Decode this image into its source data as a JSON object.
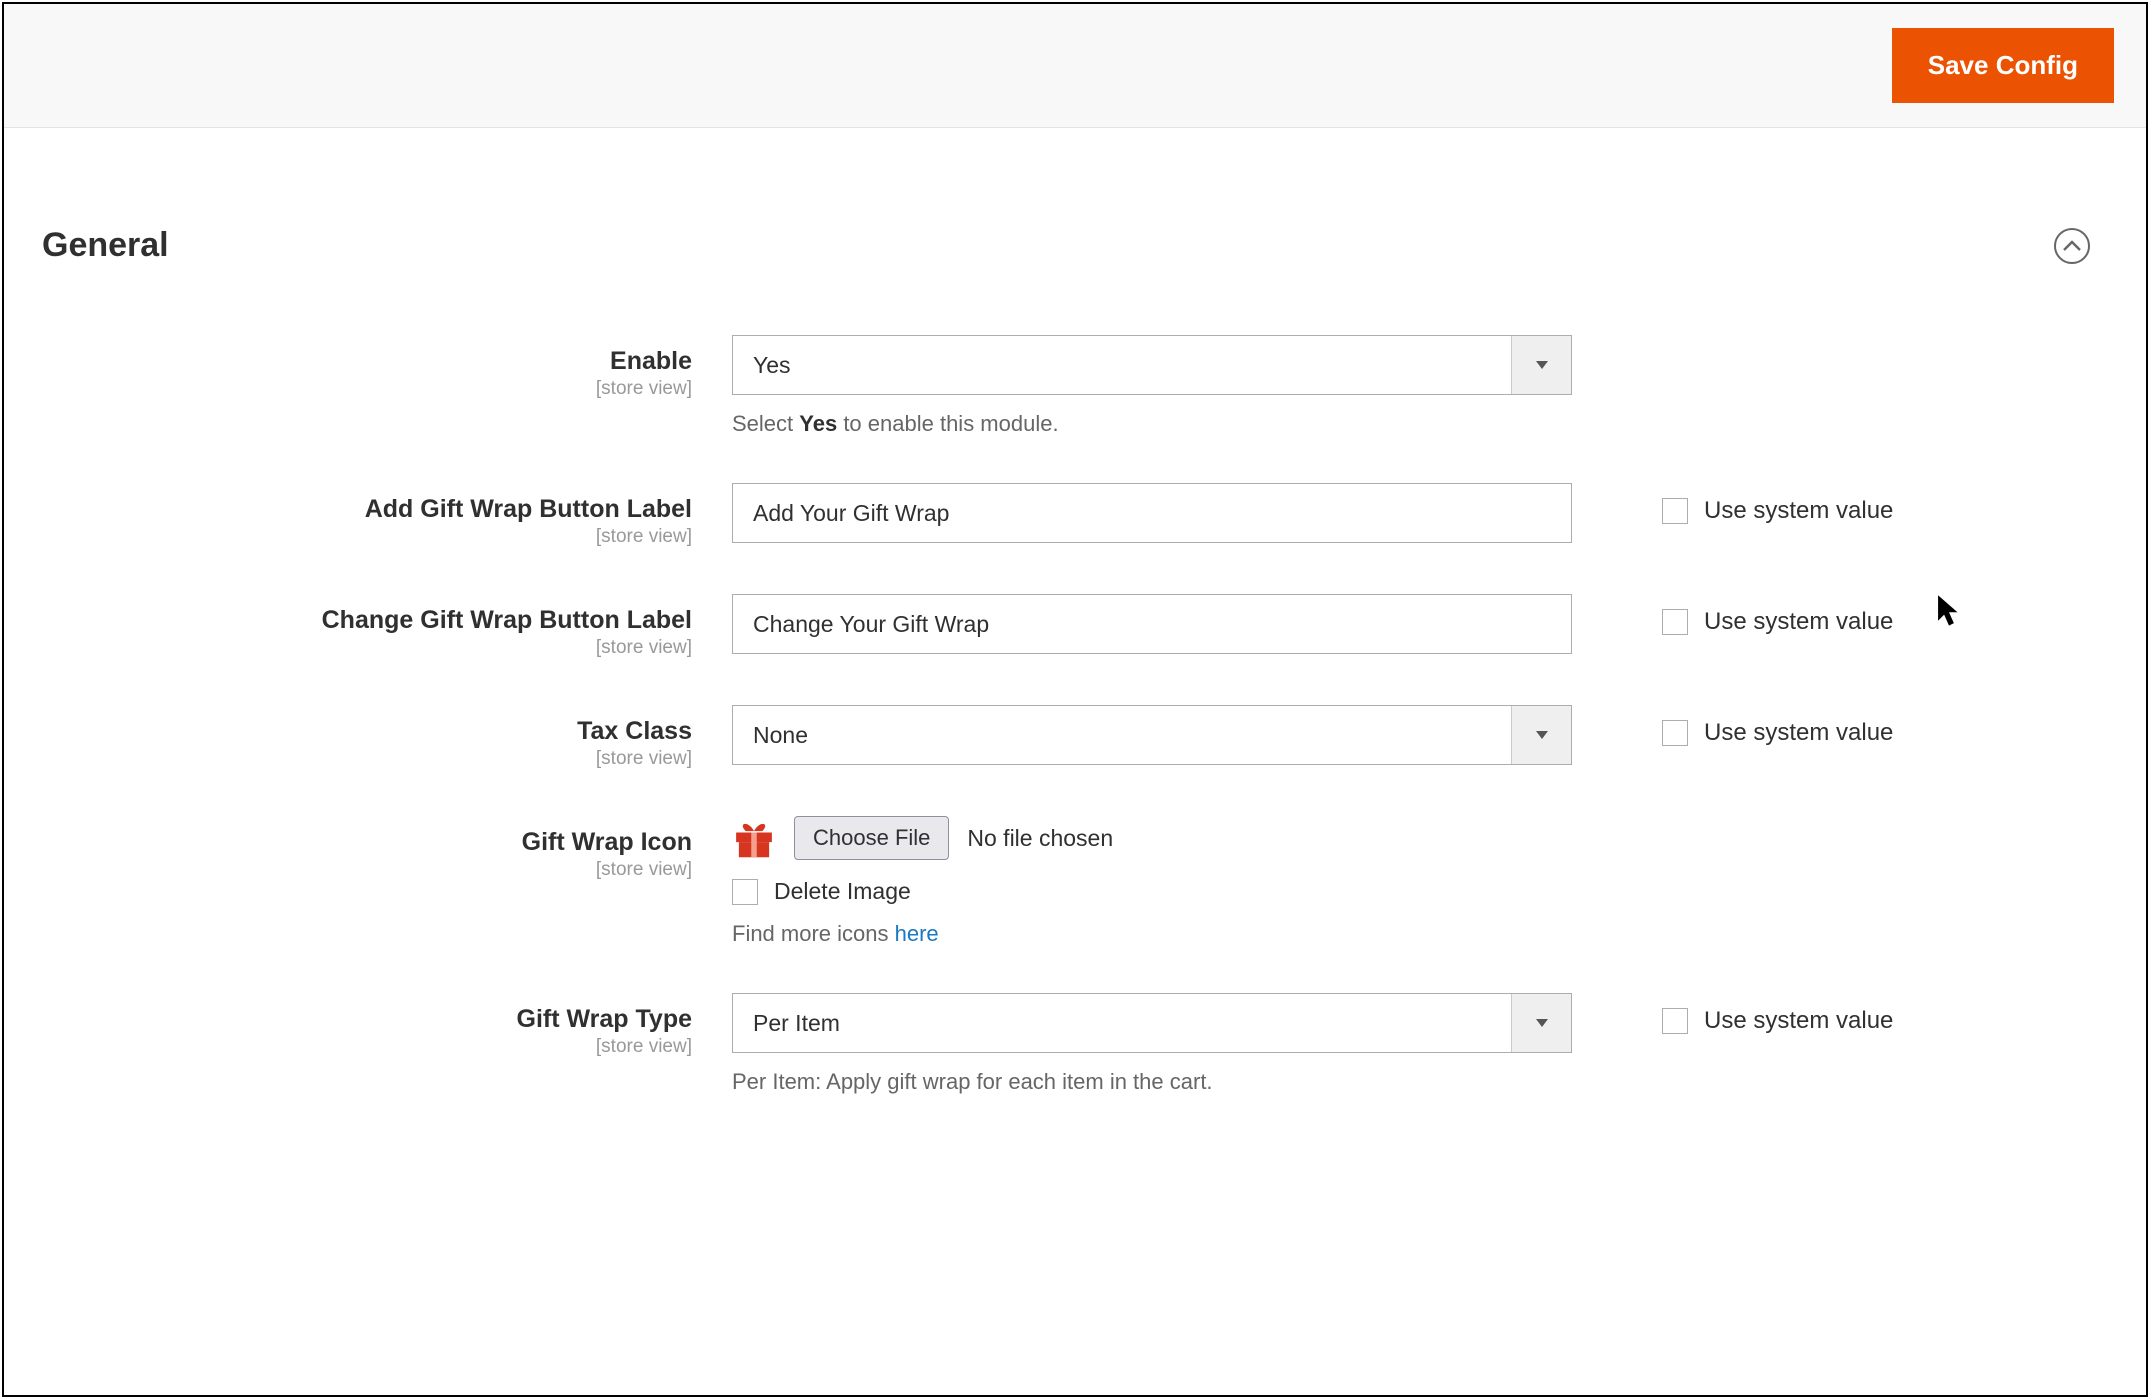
{
  "header": {
    "save_label": "Save Config"
  },
  "section": {
    "title": "General"
  },
  "scope_label": "[store view]",
  "useSystemValue": "Use system value",
  "fields": {
    "enable": {
      "label": "Enable",
      "value": "Yes",
      "helper_pre": "Select ",
      "helper_strong": "Yes",
      "helper_post": " to enable this module."
    },
    "addBtnLabel": {
      "label": "Add Gift Wrap Button Label",
      "value": "Add Your Gift Wrap"
    },
    "changeBtnLabel": {
      "label": "Change Gift Wrap Button Label",
      "value": "Change Your Gift Wrap"
    },
    "taxClass": {
      "label": "Tax Class",
      "value": "None"
    },
    "giftWrapIcon": {
      "label": "Gift Wrap Icon",
      "chooseFile": "Choose File",
      "noFile": "No file chosen",
      "deleteImage": "Delete Image",
      "helper_pre": "Find more icons ",
      "helper_link": "here"
    },
    "giftWrapType": {
      "label": "Gift Wrap Type",
      "value": "Per Item",
      "helper": "Per Item: Apply gift wrap for each item in the cart."
    }
  }
}
